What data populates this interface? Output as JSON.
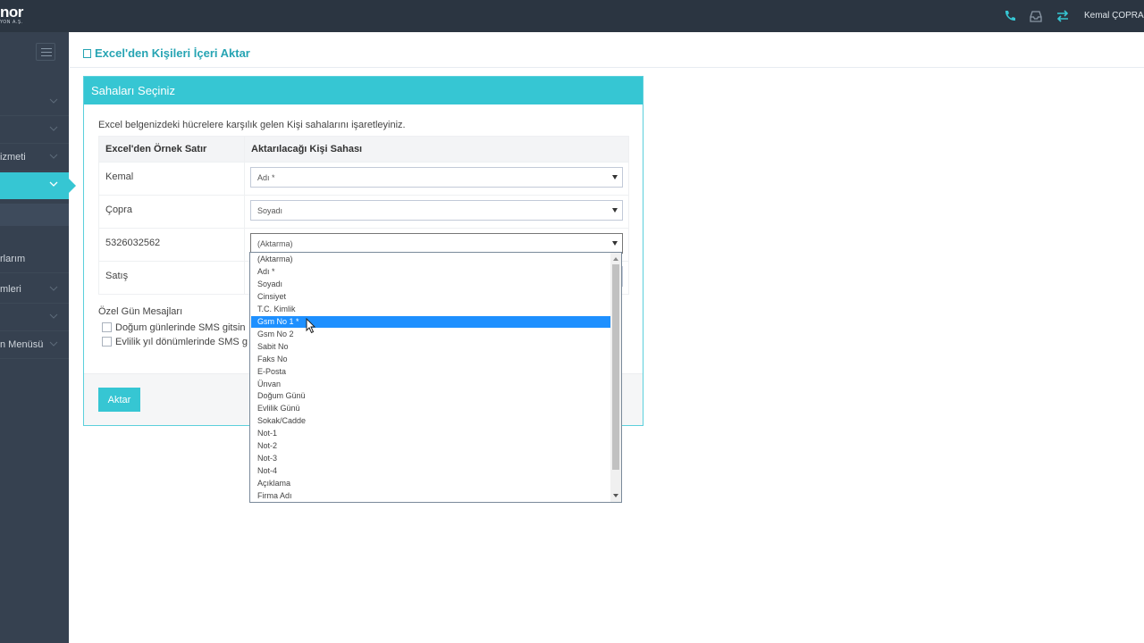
{
  "topbar": {
    "logo": "nor",
    "logo_sub": "YON A.Ş.",
    "user_name": "Kemal ÇOPRA (",
    "icons": [
      "phone-icon",
      "inbox-icon",
      "transfer-icon"
    ],
    "accent": "#36c6d3"
  },
  "sidebar": {
    "items": [
      {
        "label": ""
      },
      {
        "label": ""
      },
      {
        "label": "izmeti"
      },
      {
        "label": ""
      },
      {
        "label": ""
      },
      {
        "label": "rlarım"
      },
      {
        "label": "mleri"
      },
      {
        "label": ""
      },
      {
        "label": "n Menüsü"
      }
    ]
  },
  "page": {
    "title": "Excel'den Kişileri İçeri Aktar"
  },
  "portlet": {
    "title": "Sahaları Seçiniz",
    "intro": "Excel belgenizdeki hücrelere karşılık gelen Kişi sahalarını işaretleyiniz.",
    "columns": [
      "Excel'den Örnek Satır",
      "Aktarılacağı Kişi Sahası"
    ],
    "rows": [
      {
        "sample": "Kemal",
        "field": "Adı *"
      },
      {
        "sample": "Çopra",
        "field": "Soyadı"
      },
      {
        "sample": "5326032562",
        "field": "(Aktarma)"
      },
      {
        "sample": "Satış",
        "field": ""
      }
    ],
    "special_label": "Özel Gün Mesajları",
    "checkbox_1": "Doğum günlerinde SMS gitsin",
    "checkbox_2": "Evlilik yıl dönümlerinde SMS g",
    "submit_label": "Aktar"
  },
  "dropdown": {
    "highlighted_index": 4,
    "options": [
      "(Aktarma)",
      "Adı *",
      "Soyadı",
      "Cinsiyet",
      "T.C. Kimlik",
      "Gsm No 1 *",
      "Gsm No 2",
      "Sabit No",
      "Faks No",
      "E-Posta",
      "Ünvan",
      "Doğum Günü",
      "Evlilik Günü",
      "Sokak/Cadde",
      "Not-1",
      "Not-2",
      "Not-3",
      "Not-4",
      "Açıklama",
      "Firma Adı"
    ]
  }
}
